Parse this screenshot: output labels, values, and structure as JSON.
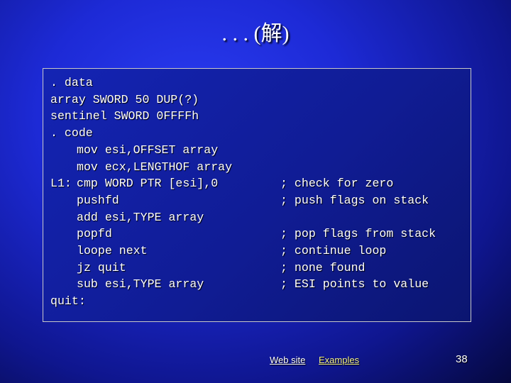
{
  "slide": {
    "title": ". . . (解)",
    "code": {
      "lines": [
        {
          "label": ". data",
          "instr": "",
          "comment": ""
        },
        {
          "label": "array SWORD 50 DUP(?)",
          "instr": "",
          "comment": ""
        },
        {
          "label": "sentinel SWORD 0FFFFh",
          "instr": "",
          "comment": ""
        },
        {
          "label": ". code",
          "instr": "",
          "comment": ""
        },
        {
          "label": "",
          "instr": "mov esi,OFFSET array",
          "comment": ""
        },
        {
          "label": "",
          "instr": "mov ecx,LENGTHOF array",
          "comment": ""
        },
        {
          "label": "L1:",
          "instr": "cmp WORD PTR [esi],0",
          "comment": "; check for zero"
        },
        {
          "label": "",
          "instr": "pushfd",
          "comment": "; push flags on stack"
        },
        {
          "label": "",
          "instr": "add esi,TYPE array",
          "comment": ""
        },
        {
          "label": "",
          "instr": "popfd",
          "comment": "; pop flags from stack"
        },
        {
          "label": "",
          "instr": "loope next",
          "comment": "; continue loop"
        },
        {
          "label": "",
          "instr": "jz quit",
          "comment": "; none found"
        },
        {
          "label": "",
          "instr": "sub esi,TYPE array",
          "comment": "; ESI points to value"
        },
        {
          "label": "quit:",
          "instr": "",
          "comment": ""
        }
      ]
    },
    "footer": {
      "web_site": "Web site",
      "examples": "Examples",
      "page_number": "38"
    }
  }
}
